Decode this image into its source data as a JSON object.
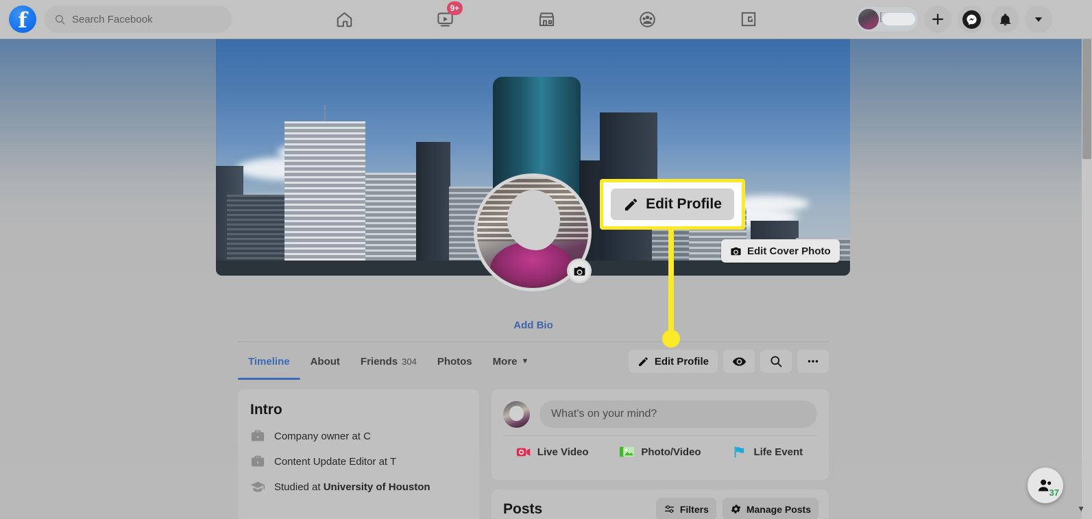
{
  "app": {
    "name": "Facebook"
  },
  "topbar": {
    "logo_icon": "facebook-logo-icon",
    "search": {
      "placeholder": "Search Facebook",
      "icon": "search-icon"
    },
    "nav": [
      {
        "name": "home",
        "icon": "home-icon",
        "badge": ""
      },
      {
        "name": "video",
        "icon": "video-play-icon",
        "badge": "9+"
      },
      {
        "name": "marketplace",
        "icon": "marketplace-storefront-icon",
        "badge": ""
      },
      {
        "name": "groups",
        "icon": "groups-people-icon",
        "badge": ""
      },
      {
        "name": "gaming",
        "icon": "gaming-icon",
        "badge": ""
      }
    ],
    "account": {
      "name_label": "[",
      "menu_icon": "chevron-down-icon",
      "create_icon": "plus-icon",
      "messenger_icon": "messenger-icon",
      "notifications_icon": "bell-icon"
    }
  },
  "cover": {
    "edit_cover_label": "Edit Cover Photo",
    "edit_cover_icon": "camera-icon",
    "profile_photo_camera_icon": "camera-icon"
  },
  "callout": {
    "label": "Edit Profile",
    "icon": "pencil-icon",
    "highlight_color": "#fbe92a",
    "box_background": "#ffffff"
  },
  "profile": {
    "add_bio_label": "Add Bio",
    "tabs": [
      {
        "label": "Timeline",
        "count": "",
        "active": true
      },
      {
        "label": "About",
        "count": "",
        "active": false
      },
      {
        "label": "Friends",
        "count": "304",
        "active": false
      },
      {
        "label": "Photos",
        "count": "",
        "active": false
      },
      {
        "label": "More",
        "count": "",
        "active": false,
        "caret": "▼"
      }
    ],
    "actions": [
      {
        "name": "edit-profile",
        "label": "Edit Profile",
        "icon": "pencil-icon"
      },
      {
        "name": "view-as",
        "label": "",
        "icon": "eye-icon"
      },
      {
        "name": "search-profile",
        "label": "",
        "icon": "search-icon"
      },
      {
        "name": "more-options",
        "label": "",
        "icon": "ellipsis-icon"
      }
    ]
  },
  "intro": {
    "title": "Intro",
    "items": [
      {
        "icon": "briefcase-icon",
        "prefix": "Company owner at ",
        "bold": "",
        "suffix": "C"
      },
      {
        "icon": "briefcase-icon",
        "prefix": "Content Update Editor at ",
        "bold": "",
        "suffix": "T"
      },
      {
        "icon": "graduation-cap-icon",
        "prefix": "Studied at ",
        "bold": "University of Houston",
        "suffix": ""
      }
    ]
  },
  "composer": {
    "placeholder": "What's on your mind?",
    "actions": [
      {
        "label": "Live Video",
        "icon": "live-video-icon",
        "color": "#e02b4e"
      },
      {
        "label": "Photo/Video",
        "icon": "photo-video-icon",
        "color": "#42b72a"
      },
      {
        "label": "Life Event",
        "icon": "life-event-flag-icon",
        "color": "#1fa8d8"
      }
    ]
  },
  "posts": {
    "title": "Posts",
    "buttons": [
      {
        "label": "Filters",
        "icon": "filters-sliders-icon"
      },
      {
        "label": "Manage Posts",
        "icon": "gear-icon"
      }
    ]
  },
  "contacts_fab": {
    "icon": "contacts-people-icon",
    "count": "37",
    "count_color": "#2e9c52",
    "caret_icon": "chevron-down-icon"
  }
}
